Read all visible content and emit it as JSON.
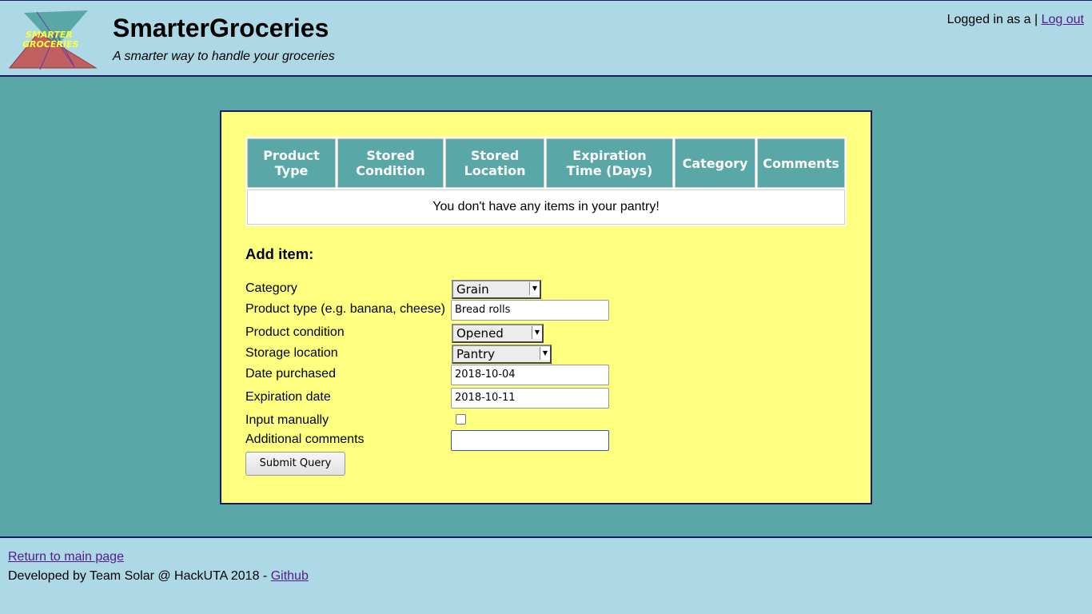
{
  "header": {
    "logo_text_line1": "SMARTER",
    "logo_text_line2": "GROCERIES",
    "title": "SmarterGroceries",
    "tagline": "A smarter way to handle your groceries",
    "logged_in_text": "Logged in as a |",
    "logout_label": "Log out"
  },
  "pantry_table": {
    "columns": [
      [
        "Product",
        "Type"
      ],
      [
        "Stored",
        "Condition"
      ],
      [
        "Stored",
        "Location"
      ],
      [
        "Expiration",
        "Time (Days)"
      ],
      [
        "Category"
      ],
      [
        "Comments"
      ]
    ],
    "empty_message": "You don't have any items in your pantry!"
  },
  "add_item": {
    "title": "Add item:",
    "category_label": "Category",
    "category_value": "Grain",
    "product_type_label": "Product type (e.g. banana, cheese)",
    "product_type_value": "Bread rolls",
    "condition_label": "Product condition",
    "condition_value": "Opened",
    "location_label": "Storage location",
    "location_value": "Pantry",
    "date_purchased_label": "Date purchased",
    "date_purchased_value": "2018-10-04",
    "expiration_label": "Expiration date",
    "expiration_value": "2018-10-11",
    "manual_label": "Input manually",
    "manual_checked": false,
    "comments_label": "Additional comments",
    "comments_value": "",
    "submit_label": "Submit Query"
  },
  "footer": {
    "return_link": "Return to main page",
    "dev_text": "Developed by Team Solar @ HackUTA 2018 -",
    "github_link": "Github"
  },
  "colors": {
    "page_bg": "#5aa7a7",
    "header_bg": "#add8e6",
    "panel_bg": "#ffff80",
    "table_header_bg": "#5aa7a7",
    "border": "#1a1a66",
    "link": "#551a8b"
  }
}
